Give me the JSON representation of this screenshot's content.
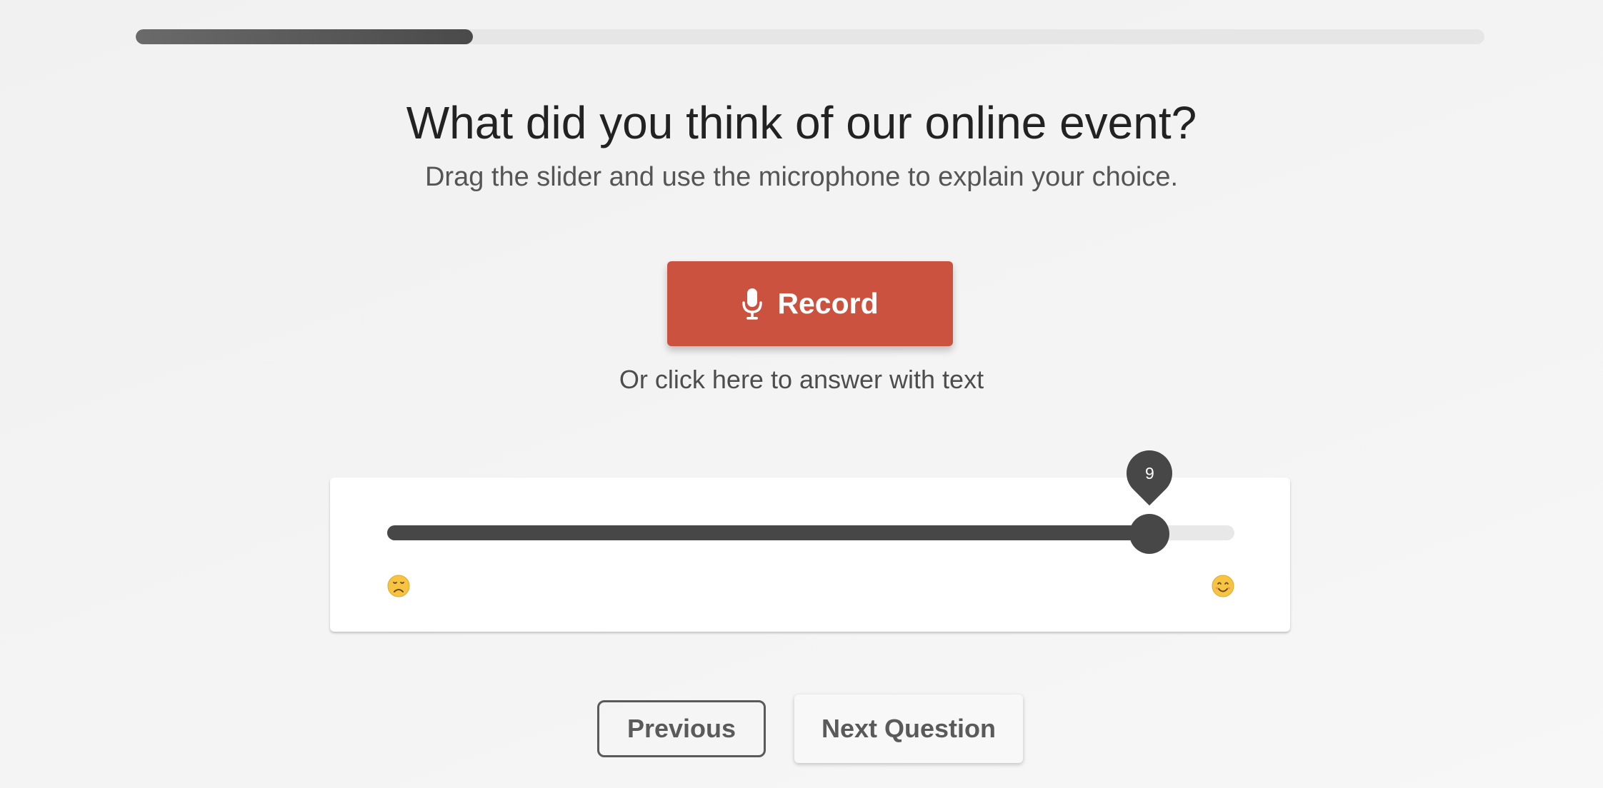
{
  "progress": {
    "percent": 25
  },
  "question": {
    "title": "What did you think of our online event?",
    "subtitle": "Drag the slider and use the microphone to explain your choice."
  },
  "record_button": {
    "label": "Record",
    "icon": "microphone-icon",
    "color": "#cc5240"
  },
  "text_answer_link": "Or click here to answer with text",
  "slider": {
    "min": 0,
    "max": 10,
    "value": 9,
    "value_label": "9",
    "left_icon": "sad-face-icon",
    "right_icon": "smiling-face-icon"
  },
  "navigation": {
    "previous_label": "Previous",
    "next_label": "Next Question"
  }
}
